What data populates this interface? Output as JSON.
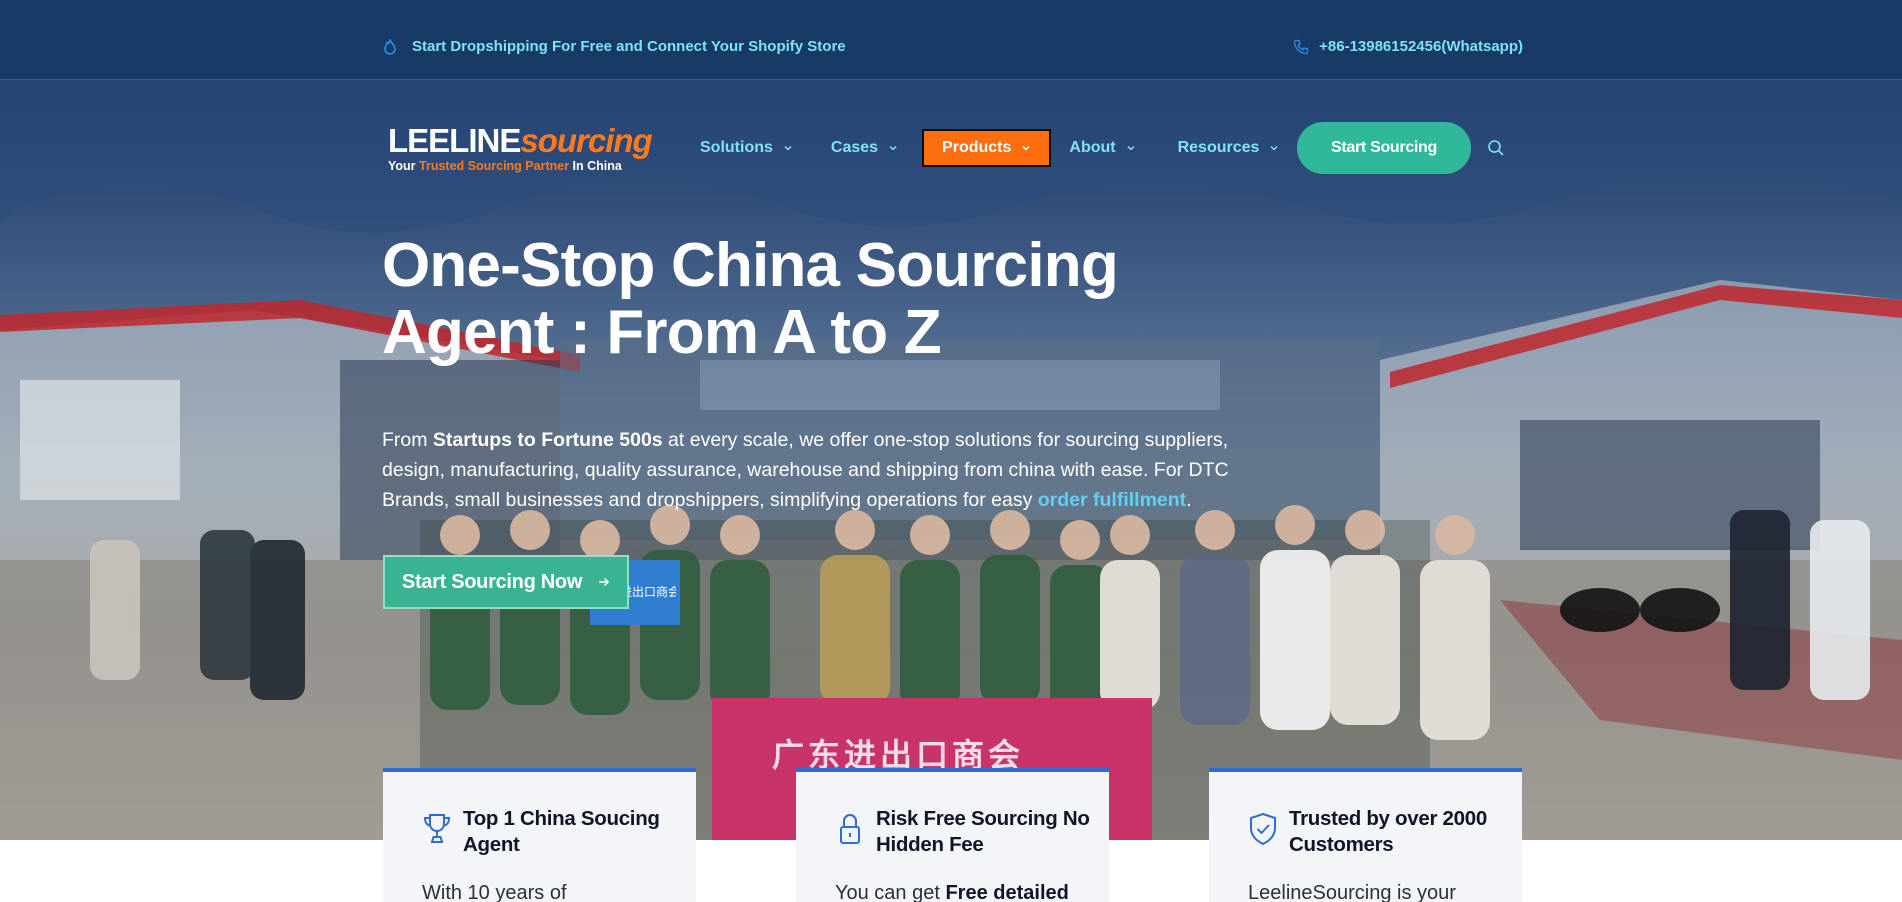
{
  "topbar": {
    "promo": "Start Dropshipping For Free and Connect Your Shopify Store",
    "phone": "+86-13986152456(Whatsapp)"
  },
  "logo": {
    "word_part1": "LEELINE",
    "word_part2": "sourcing",
    "tagline_part1": "Your ",
    "tagline_part2": "Trusted Sourcing Partner",
    "tagline_part3": " In China"
  },
  "nav": {
    "items": [
      {
        "label": "Solutions",
        "active": false
      },
      {
        "label": "Cases",
        "active": false
      },
      {
        "label": "Products",
        "active": true
      },
      {
        "label": "About",
        "active": false
      },
      {
        "label": "Resources",
        "active": false
      }
    ],
    "cta": "Start Sourcing"
  },
  "hero": {
    "headline_line1": "One-Stop China Sourcing",
    "headline_line2": "Agent : From A to Z",
    "intro_prefix": "From ",
    "intro_bold": "Startups to Fortune 500s",
    "intro_body": " at every scale, we offer one-stop solutions for sourcing suppliers, design, manufacturing, quality assurance, warehouse and shipping from china with ease. For DTC Brands, small businesses and dropshippers, simplifying operations for easy ",
    "intro_link": "order fulfillment",
    "intro_end": ".",
    "cta": "Start Sourcing Now",
    "banner_text": "广东进出口商会",
    "sign_text": "广东进出口商会"
  },
  "cards": [
    {
      "icon": "trophy-icon",
      "title": "Top 1 China Soucing Agent",
      "text_plain": "With 10 years of",
      "text_bold": ""
    },
    {
      "icon": "lock-icon",
      "title": "Risk Free Sourcing No Hidden Fee",
      "text_plain": "You can get ",
      "text_bold": "Free detailed"
    },
    {
      "icon": "shield-check-icon",
      "title": "Trusted by over 2000 Customers",
      "text_plain": "LeelineSourcing is your",
      "text_bold": ""
    }
  ],
  "colors": {
    "topbar": "#173a66",
    "accent_cyan": "#7fe3f0",
    "orange": "#ff6e0e",
    "teal": "#2fb89a",
    "card_border": "#2f6bd8"
  }
}
